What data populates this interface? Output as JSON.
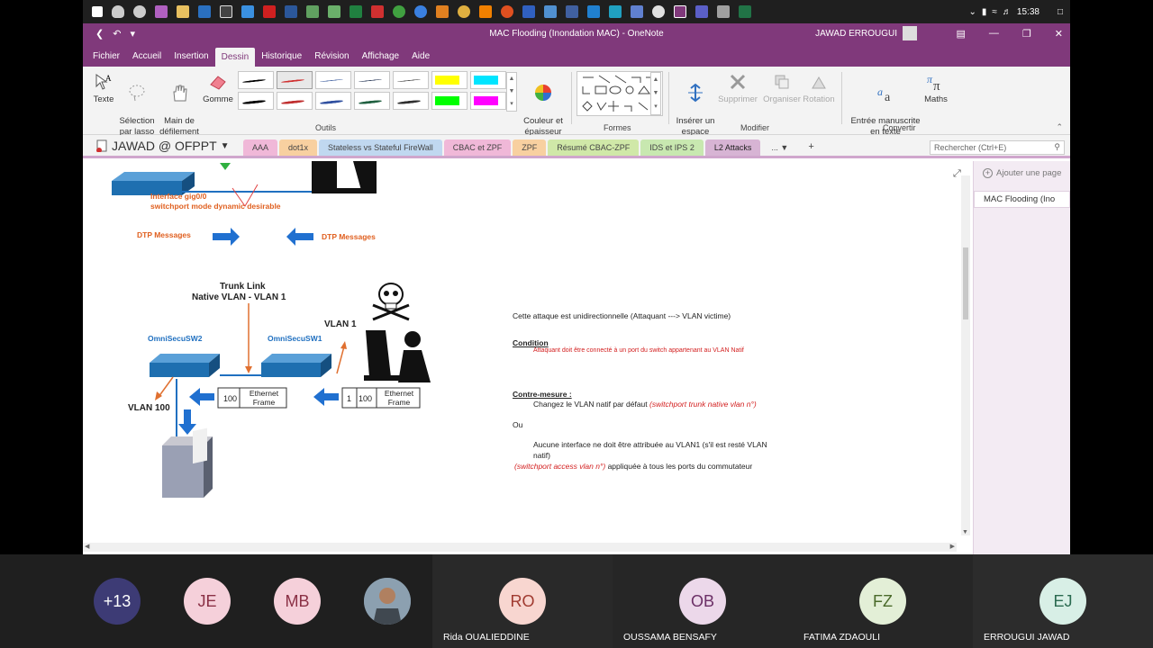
{
  "taskbar": {
    "time": "15:38"
  },
  "window": {
    "title": "MAC Flooding (Inondation MAC)  -  OneNote",
    "user": "JAWAD ERROUGUI",
    "menu": [
      "Fichier",
      "Accueil",
      "Insertion",
      "Dessin",
      "Historique",
      "Révision",
      "Affichage",
      "Aide"
    ],
    "active_menu": "Dessin"
  },
  "ribbon": {
    "texte": "Texte",
    "selection": "Sélection\npar lasso",
    "main": "Main de\ndéfilement",
    "gomme": "Gomme",
    "outils": "Outils",
    "couleur": "Couleur et\népaisseur",
    "formes": "Formes",
    "inserer": "Insérer un\nespace",
    "supprimer": "Supprimer",
    "organiser": "Organiser",
    "rotation": "Rotation",
    "modifier": "Modifier",
    "entree": "Entrée manuscrite\nen texte",
    "maths": "Maths",
    "convertir": "Convertir",
    "highlight_colors": [
      "#ffff00",
      "#00e5ff",
      "#00ff00",
      "#ff00ff"
    ],
    "pen_colors": [
      "#000000",
      "#d03030",
      "#4060a0",
      "#203050",
      "#404040",
      "#000000",
      "#c03030",
      "#3050a0",
      "#206040",
      "#303030"
    ]
  },
  "notebook": {
    "name": "JAWAD @ OFPPT",
    "tabs": [
      {
        "label": "AAA",
        "color": "#f0b8d8"
      },
      {
        "label": "dot1x",
        "color": "#f8d0a0"
      },
      {
        "label": "Stateless vs Stateful FireWall",
        "color": "#c0d8f0"
      },
      {
        "label": "CBAC et ZPF",
        "color": "#f0b8d8"
      },
      {
        "label": "ZPF",
        "color": "#f8d0a0"
      },
      {
        "label": "Résumé CBAC-ZPF",
        "color": "#d0e8a8"
      },
      {
        "label": "IDS et IPS 2",
        "color": "#c8e8b0"
      },
      {
        "label": "L2 Attacks",
        "color": "#d7b4d4"
      },
      {
        "label": "...",
        "color": "#f3f3f3"
      }
    ],
    "search_placeholder": "Rechercher (Ctrl+E)",
    "add_page": "Ajouter une page",
    "page": "MAC Flooding (Ino"
  },
  "diagram": {
    "iface": "Interface gig0/0",
    "switchport": "switchport mode dynamic desirable",
    "dtp_left": "DTP Messages",
    "dtp_right": "DTP Messages",
    "trunk": "Trunk Link",
    "native": "Native VLAN -  VLAN 1",
    "sw2": "OmniSecuSW2",
    "sw1": "OmniSecuSW1",
    "vlan1": "VLAN 1",
    "vlan100": "VLAN 100",
    "frame_a_num": "100",
    "frame_a_text": "Ethernet\nFrame",
    "frame_b_num1": "1",
    "frame_b_num2": "100",
    "frame_b_text": "Ethernet\nFrame"
  },
  "notes": {
    "line1": "Cette attaque est unidirectionnelle (Attaquant ---> VLAN victime)",
    "condition_title": "Condition",
    "condition_text": "Attaquant doit être connecté à un port du switch appartenant au VLAN Natif",
    "contre_title": "Contre-mesure :",
    "contre_text": "Changez le VLAN natif par défaut",
    "contre_cmd": "(switchport trunk native vlan n°)",
    "ou": "Ou",
    "aucune": "Aucune interface ne doit être attribuée au VLAN1 (s'il est resté VLAN natif)",
    "cmd2": "(switchport access vlan n°)",
    "cmd2_text": " appliquée à tous les ports du commutateur"
  },
  "participants": [
    {
      "initials": "+13",
      "bg": "#3d3b75",
      "fg": "#ffffff",
      "name": ""
    },
    {
      "initials": "JE",
      "bg": "#f5d0da",
      "fg": "#8a3045",
      "name": ""
    },
    {
      "initials": "MB",
      "bg": "#f5d0da",
      "fg": "#8a3045",
      "name": ""
    },
    {
      "initials": "",
      "bg": "#6a7f90",
      "fg": "#ffffff",
      "name": ""
    },
    {
      "initials": "RO",
      "bg": "#f8d6d0",
      "fg": "#a03a30",
      "name": "Rida OUALIEDDINE"
    },
    {
      "initials": "OB",
      "bg": "#ecd8ea",
      "fg": "#6b2f66",
      "name": "OUSSAMA BENSAFY"
    },
    {
      "initials": "FZ",
      "bg": "#e3efd7",
      "fg": "#4a6a2a",
      "name": "FATIMA ZDAOULI"
    },
    {
      "initials": "EJ",
      "bg": "#d8efe6",
      "fg": "#2a6a50",
      "name": "ERROUGUI JAWAD"
    }
  ]
}
